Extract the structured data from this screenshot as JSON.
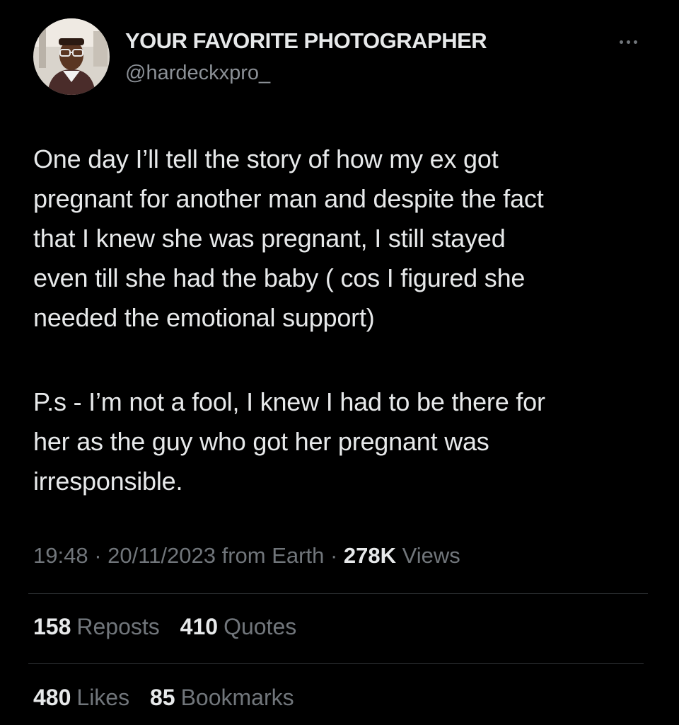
{
  "author": {
    "display_name": "YOUR FAVORITE PHOTOGRAPHER",
    "handle": "@hardeckxpro_",
    "avatar": "profile-photo"
  },
  "more_icon": "ellipsis-icon",
  "tweet": {
    "paragraph1": "One day I’ll tell the story of how my ex got\npregnant for another man and despite the fact\nthat I knew she was pregnant, I still stayed\neven till she had the baby ( cos I figured she\nneeded the emotional support)",
    "paragraph2": "P.s - I’m not a fool, I knew I had to be there for\nher as the guy who got her pregnant was\nirresponsible."
  },
  "meta": {
    "time": "19:48",
    "sep1": " · ",
    "date": "20/11/2023",
    "source": " from Earth",
    "sep2": " · ",
    "views_count": "278K",
    "views_label": " Views"
  },
  "stats": {
    "reposts_count": "158",
    "reposts_label": "Reposts",
    "quotes_count": "410",
    "quotes_label": "Quotes",
    "likes_count": "480",
    "likes_label": "Likes",
    "bookmarks_count": "85",
    "bookmarks_label": "Bookmarks"
  },
  "colors": {
    "background": "#000000",
    "text_primary": "#e7e9ea",
    "text_secondary": "#71767b",
    "divider": "#2f3336"
  }
}
